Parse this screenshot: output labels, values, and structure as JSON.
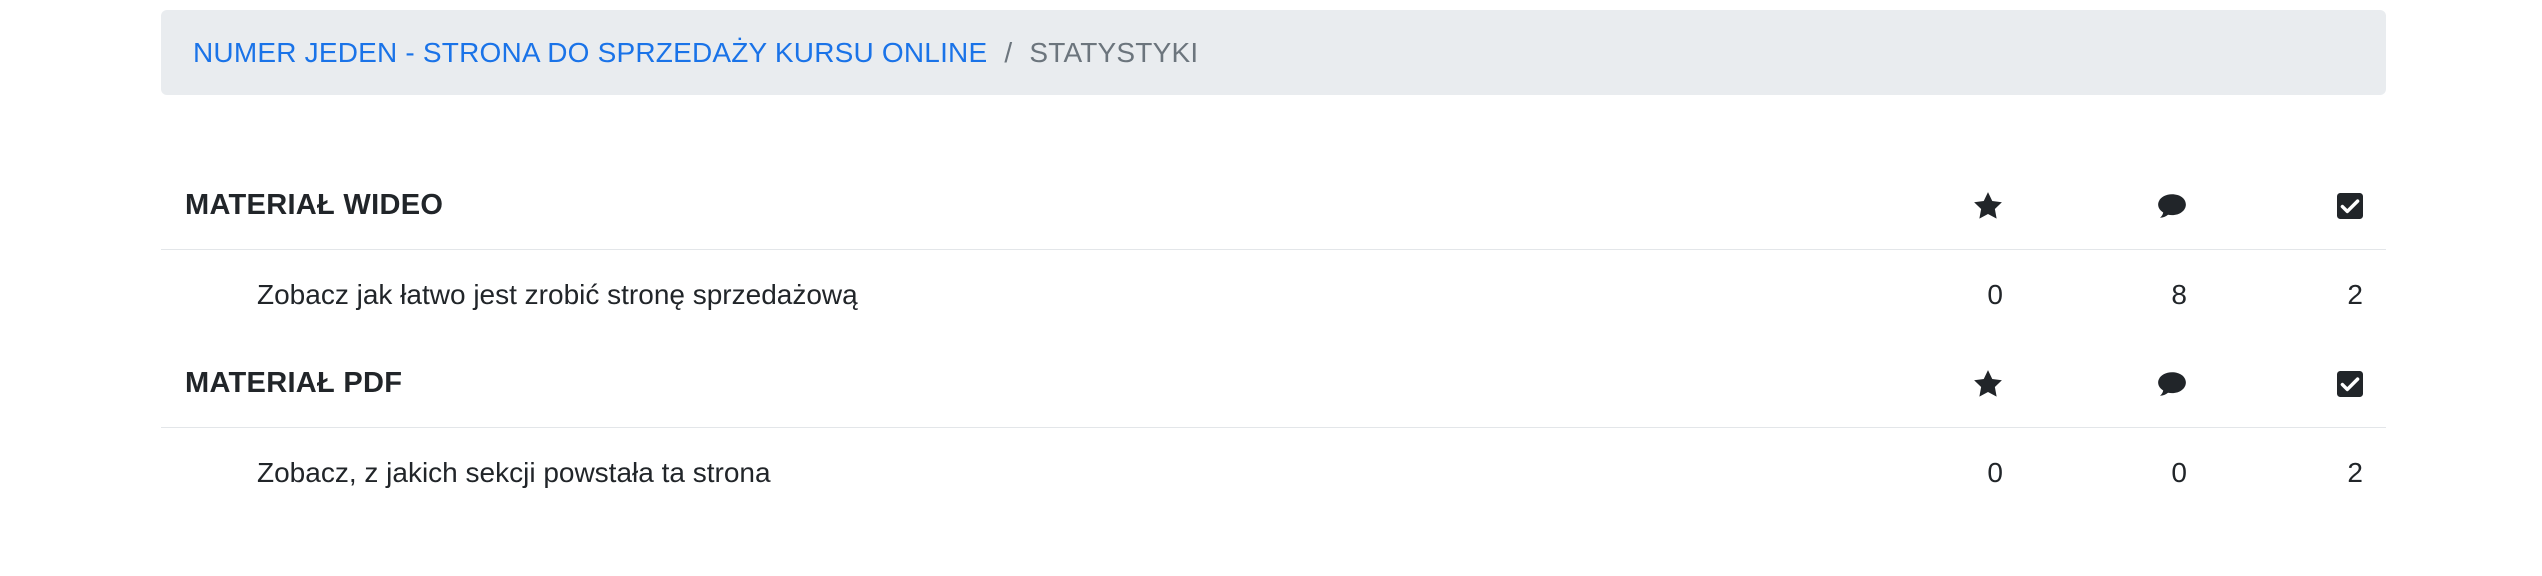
{
  "breadcrumb": {
    "link": "NUMER JEDEN - STRONA DO SPRZEDAŻY KURSU ONLINE",
    "separator": "/",
    "current": "STATYSTYKI"
  },
  "columns": {
    "col1_icon": "star-icon",
    "col2_icon": "comment-icon",
    "col3_icon": "checked-square-icon"
  },
  "sections": [
    {
      "title": "MATERIAŁ WIDEO",
      "items": [
        {
          "title": "Zobacz jak łatwo jest zrobić stronę sprzedażową",
          "col1": "0",
          "col2": "8",
          "col3": "2"
        }
      ]
    },
    {
      "title": "MATERIAŁ PDF",
      "items": [
        {
          "title": "Zobacz, z jakich sekcji powstała ta strona",
          "col1": "0",
          "col2": "0",
          "col3": "2"
        }
      ]
    }
  ]
}
